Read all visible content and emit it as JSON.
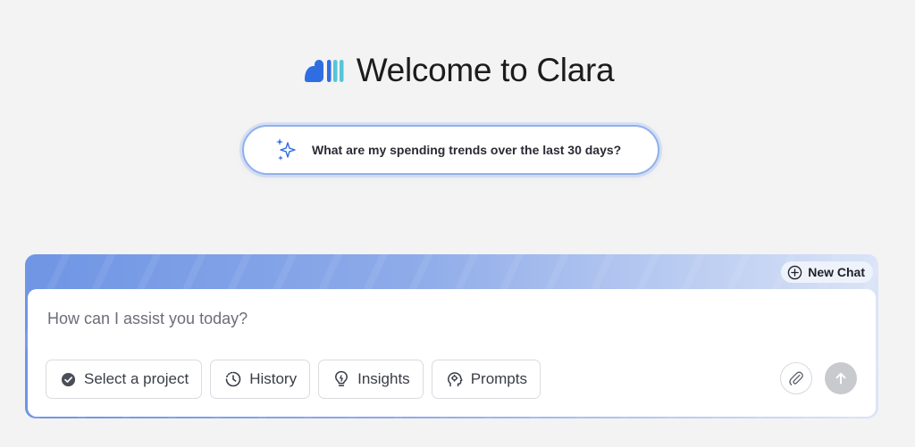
{
  "header": {
    "title": "Welcome to Clara",
    "logo_icon": "clara-logo-icon"
  },
  "suggestion": {
    "text": "What are my spending trends over the last 30 days?",
    "icon": "sparkle-icon"
  },
  "chat": {
    "new_chat_label": "New Chat",
    "input_placeholder": "How can I assist you today?",
    "input_value": "",
    "tools": [
      {
        "label": "Select a project",
        "icon": "check-circle-icon"
      },
      {
        "label": "History",
        "icon": "history-icon"
      },
      {
        "label": "Insights",
        "icon": "lightbulb-icon"
      },
      {
        "label": "Prompts",
        "icon": "brain-icon"
      }
    ],
    "attach_icon": "paperclip-icon",
    "send_icon": "arrow-up-icon"
  },
  "colors": {
    "logo_blue": "#2f6de3",
    "logo_teal": "#57c5d9",
    "panel_gradient_start": "#6f95e4",
    "panel_gradient_end": "#dbe4f7",
    "suggestion_border": "#8fb0ec",
    "send_button": "#c9cacd"
  }
}
